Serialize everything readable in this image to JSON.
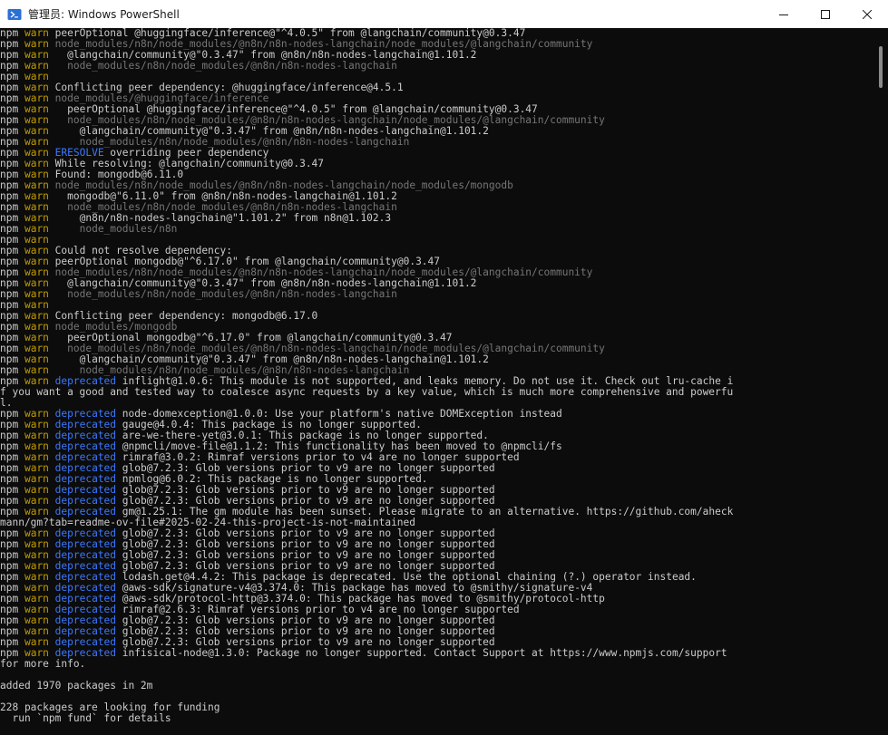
{
  "window": {
    "title": "管理员: Windows PowerShell",
    "controls": {
      "minimize": "—",
      "maximize": "☐",
      "close": "✕"
    }
  },
  "console": {
    "lines": [
      {
        "p": true,
        "text": "peerOptional @huggingface/inference@\"^4.0.5\" from @langchain/community@0.3.47",
        "style": "normal"
      },
      {
        "p": true,
        "text": "node_modules/n8n/node_modules/@n8n/n8n-nodes-langchain/node_modules/@langchain/community",
        "style": "dim"
      },
      {
        "p": true,
        "text": "  @langchain/community@\"0.3.47\" from @n8n/n8n-nodes-langchain@1.101.2",
        "style": "normal"
      },
      {
        "p": true,
        "text": "  node_modules/n8n/node_modules/@n8n/n8n-nodes-langchain",
        "style": "dim"
      },
      {
        "p": true,
        "text": "",
        "style": "normal"
      },
      {
        "p": true,
        "text": "Conflicting peer dependency: @huggingface/inference@4.5.1",
        "style": "normal"
      },
      {
        "p": true,
        "text": "node_modules/@huggingface/inference",
        "style": "dim"
      },
      {
        "p": true,
        "text": "  peerOptional @huggingface/inference@\"^4.0.5\" from @langchain/community@0.3.47",
        "style": "normal"
      },
      {
        "p": true,
        "text": "  node_modules/n8n/node_modules/@n8n/n8n-nodes-langchain/node_modules/@langchain/community",
        "style": "dim"
      },
      {
        "p": true,
        "text": "    @langchain/community@\"0.3.47\" from @n8n/n8n-nodes-langchain@1.101.2",
        "style": "normal"
      },
      {
        "p": true,
        "text": "    node_modules/n8n/node_modules/@n8n/n8n-nodes-langchain",
        "style": "dim"
      },
      {
        "p": true,
        "tag": "ERESOLVE",
        "text": " overriding peer dependency",
        "style": "normal"
      },
      {
        "p": true,
        "text": "While resolving: @langchain/community@0.3.47",
        "style": "normal"
      },
      {
        "p": true,
        "text": "Found: mongodb@6.11.0",
        "style": "normal"
      },
      {
        "p": true,
        "text": "node_modules/n8n/node_modules/@n8n/n8n-nodes-langchain/node_modules/mongodb",
        "style": "dim"
      },
      {
        "p": true,
        "text": "  mongodb@\"6.11.0\" from @n8n/n8n-nodes-langchain@1.101.2",
        "style": "normal"
      },
      {
        "p": true,
        "text": "  node_modules/n8n/node_modules/@n8n/n8n-nodes-langchain",
        "style": "dim"
      },
      {
        "p": true,
        "text": "    @n8n/n8n-nodes-langchain@\"1.101.2\" from n8n@1.102.3",
        "style": "normal"
      },
      {
        "p": true,
        "text": "    node_modules/n8n",
        "style": "dim"
      },
      {
        "p": true,
        "text": "",
        "style": "normal"
      },
      {
        "p": true,
        "text": "Could not resolve dependency:",
        "style": "normal"
      },
      {
        "p": true,
        "text": "peerOptional mongodb@\"^6.17.0\" from @langchain/community@0.3.47",
        "style": "normal"
      },
      {
        "p": true,
        "text": "node_modules/n8n/node_modules/@n8n/n8n-nodes-langchain/node_modules/@langchain/community",
        "style": "dim"
      },
      {
        "p": true,
        "text": "  @langchain/community@\"0.3.47\" from @n8n/n8n-nodes-langchain@1.101.2",
        "style": "normal"
      },
      {
        "p": true,
        "text": "  node_modules/n8n/node_modules/@n8n/n8n-nodes-langchain",
        "style": "dim"
      },
      {
        "p": true,
        "text": "",
        "style": "normal"
      },
      {
        "p": true,
        "text": "Conflicting peer dependency: mongodb@6.17.0",
        "style": "normal"
      },
      {
        "p": true,
        "text": "node_modules/mongodb",
        "style": "dim"
      },
      {
        "p": true,
        "text": "  peerOptional mongodb@\"^6.17.0\" from @langchain/community@0.3.47",
        "style": "normal"
      },
      {
        "p": true,
        "text": "  node_modules/n8n/node_modules/@n8n/n8n-nodes-langchain/node_modules/@langchain/community",
        "style": "dim"
      },
      {
        "p": true,
        "text": "    @langchain/community@\"0.3.47\" from @n8n/n8n-nodes-langchain@1.101.2",
        "style": "normal"
      },
      {
        "p": true,
        "text": "    node_modules/n8n/node_modules/@n8n/n8n-nodes-langchain",
        "style": "dim"
      },
      {
        "p": true,
        "tag": "deprecated",
        "text": " inflight@1.0.6: This module is not supported, and leaks memory. Do not use it. Check out lru-cache i",
        "style": "normal"
      },
      {
        "p": false,
        "text": "f you want a good and tested way to coalesce async requests by a key value, which is much more comprehensive and powerfu",
        "style": "normal"
      },
      {
        "p": false,
        "text": "l.",
        "style": "normal"
      },
      {
        "p": true,
        "tag": "deprecated",
        "text": " node-domexception@1.0.0: Use your platform's native DOMException instead",
        "style": "normal"
      },
      {
        "p": true,
        "tag": "deprecated",
        "text": " gauge@4.0.4: This package is no longer supported.",
        "style": "normal"
      },
      {
        "p": true,
        "tag": "deprecated",
        "text": " are-we-there-yet@3.0.1: This package is no longer supported.",
        "style": "normal"
      },
      {
        "p": true,
        "tag": "deprecated",
        "text": " @npmcli/move-file@1.1.2: This functionality has been moved to @npmcli/fs",
        "style": "normal"
      },
      {
        "p": true,
        "tag": "deprecated",
        "text": " rimraf@3.0.2: Rimraf versions prior to v4 are no longer supported",
        "style": "normal"
      },
      {
        "p": true,
        "tag": "deprecated",
        "text": " glob@7.2.3: Glob versions prior to v9 are no longer supported",
        "style": "normal"
      },
      {
        "p": true,
        "tag": "deprecated",
        "text": " npmlog@6.0.2: This package is no longer supported.",
        "style": "normal"
      },
      {
        "p": true,
        "tag": "deprecated",
        "text": " glob@7.2.3: Glob versions prior to v9 are no longer supported",
        "style": "normal"
      },
      {
        "p": true,
        "tag": "deprecated",
        "text": " glob@7.2.3: Glob versions prior to v9 are no longer supported",
        "style": "normal"
      },
      {
        "p": true,
        "tag": "deprecated",
        "text": " gm@1.25.1: The gm module has been sunset. Please migrate to an alternative. https://github.com/aheck",
        "style": "normal"
      },
      {
        "p": false,
        "text": "mann/gm?tab=readme-ov-file#2025-02-24-this-project-is-not-maintained",
        "style": "normal"
      },
      {
        "p": true,
        "tag": "deprecated",
        "text": " glob@7.2.3: Glob versions prior to v9 are no longer supported",
        "style": "normal"
      },
      {
        "p": true,
        "tag": "deprecated",
        "text": " glob@7.2.3: Glob versions prior to v9 are no longer supported",
        "style": "normal"
      },
      {
        "p": true,
        "tag": "deprecated",
        "text": " glob@7.2.3: Glob versions prior to v9 are no longer supported",
        "style": "normal"
      },
      {
        "p": true,
        "tag": "deprecated",
        "text": " glob@7.2.3: Glob versions prior to v9 are no longer supported",
        "style": "normal"
      },
      {
        "p": true,
        "tag": "deprecated",
        "text": " lodash.get@4.4.2: This package is deprecated. Use the optional chaining (?.) operator instead.",
        "style": "normal"
      },
      {
        "p": true,
        "tag": "deprecated",
        "text": " @aws-sdk/signature-v4@3.374.0: This package has moved to @smithy/signature-v4",
        "style": "normal"
      },
      {
        "p": true,
        "tag": "deprecated",
        "text": " @aws-sdk/protocol-http@3.374.0: This package has moved to @smithy/protocol-http",
        "style": "normal"
      },
      {
        "p": true,
        "tag": "deprecated",
        "text": " rimraf@2.6.3: Rimraf versions prior to v4 are no longer supported",
        "style": "normal"
      },
      {
        "p": true,
        "tag": "deprecated",
        "text": " glob@7.2.3: Glob versions prior to v9 are no longer supported",
        "style": "normal"
      },
      {
        "p": true,
        "tag": "deprecated",
        "text": " glob@7.2.3: Glob versions prior to v9 are no longer supported",
        "style": "normal"
      },
      {
        "p": true,
        "tag": "deprecated",
        "text": " glob@7.2.3: Glob versions prior to v9 are no longer supported",
        "style": "normal"
      },
      {
        "p": true,
        "tag": "deprecated",
        "text": " infisical-node@1.3.0: Package no longer supported. Contact Support at https://www.npmjs.com/support",
        "style": "normal"
      },
      {
        "p": false,
        "text": "for more info.",
        "style": "normal"
      },
      {
        "p": false,
        "text": "",
        "style": "normal"
      },
      {
        "p": false,
        "text": "added 1970 packages in 2m",
        "style": "normal"
      },
      {
        "p": false,
        "text": "",
        "style": "normal"
      },
      {
        "p": false,
        "text": "228 packages are looking for funding",
        "style": "normal"
      },
      {
        "p": false,
        "text": "  run `npm fund` for details",
        "style": "normal"
      }
    ]
  },
  "prefix": {
    "npm": "npm",
    "warn": "warn"
  },
  "icons": {
    "app": "powershell-icon",
    "minimize": "minimize-icon",
    "maximize": "maximize-icon",
    "close": "close-icon"
  }
}
